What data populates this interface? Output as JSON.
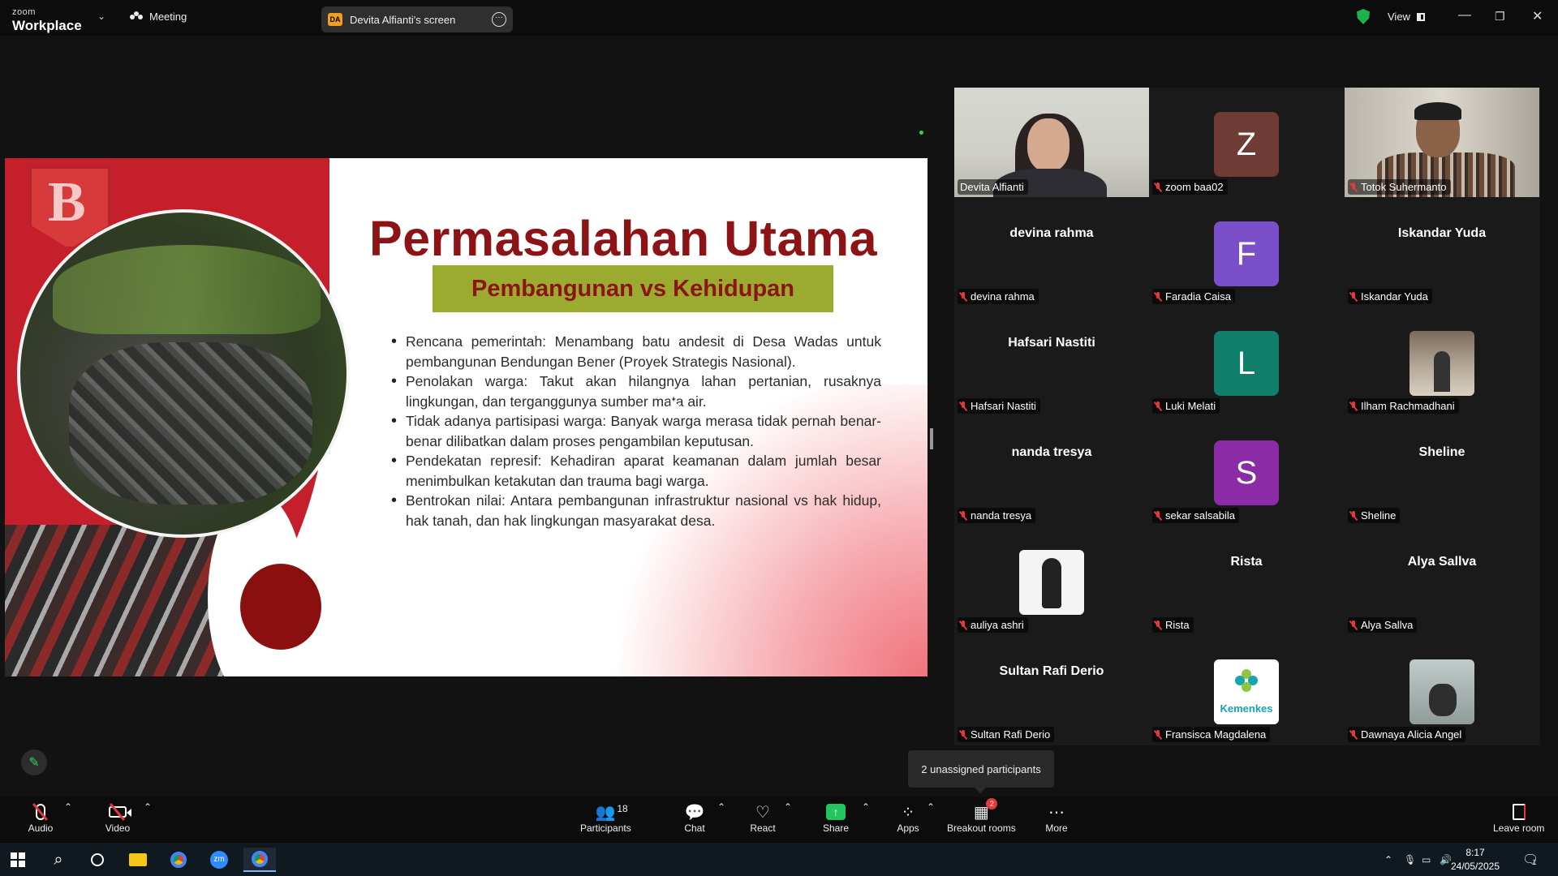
{
  "app": {
    "logo_top": "zoom",
    "logo_bottom": "Workplace",
    "meeting_label": "Meeting",
    "screen_share_pill": "Devita Alfianti's screen",
    "screen_share_initials": "DA",
    "view_label": "View"
  },
  "slide": {
    "title": "Permasalahan Utama",
    "subtitle": "Pembangunan vs Kehidupan",
    "logo_letter": "B",
    "bullets": [
      "Rencana pemerintah: Menambang batu andesit di Desa Wadas untuk pembangunan Bendungan Bener (Proyek Strategis Nasional).",
      "Penolakan warga: Takut akan hilangnya lahan pertanian, rusaknya lingkungan, dan terganggunya sumber mata air.",
      "Tidak adanya partisipasi warga: Banyak warga merasa tidak pernah benar-benar dilibatkan dalam proses pengambilan keputusan.",
      "Pendekatan represif: Kehadiran aparat keamanan dalam jumlah besar menimbulkan ketakutan dan trauma bagi warga.",
      "Bentrokan nilai: Antara pembangunan infrastruktur nasional vs hak hidup, hak tanah, dan hak lingkungan masyarakat desa."
    ]
  },
  "participants": [
    {
      "name": "Devita Alfianti",
      "type": "video-devita",
      "active": true,
      "muted": false
    },
    {
      "name": "zoom baa02",
      "type": "letter",
      "letter": "Z",
      "color": "#6e3b35",
      "muted": true
    },
    {
      "name": "Totok Suhermanto",
      "type": "video-totok",
      "muted": true
    },
    {
      "name": "devina rahma",
      "type": "name",
      "muted": true
    },
    {
      "name": "Faradia Caisa",
      "type": "letter",
      "letter": "F",
      "color": "#7b4fc9",
      "muted": true
    },
    {
      "name": "Iskandar Yuda",
      "type": "name",
      "muted": true
    },
    {
      "name": "Hafsari Nastiti",
      "type": "name",
      "muted": true
    },
    {
      "name": "Luki Melati",
      "type": "letter",
      "letter": "L",
      "color": "#0f7f6c",
      "muted": true
    },
    {
      "name": "Ilham Rachmadhani",
      "type": "pic-ilham",
      "muted": true
    },
    {
      "name": "nanda tresya",
      "type": "name",
      "muted": true
    },
    {
      "name": "sekar salsabila",
      "type": "letter",
      "letter": "S",
      "color": "#8b2ca6",
      "muted": true
    },
    {
      "name": "Sheline",
      "type": "name",
      "muted": true
    },
    {
      "name": "auliya ashri",
      "type": "pic-auliya",
      "muted": true
    },
    {
      "name": "Rista",
      "type": "name",
      "muted": true
    },
    {
      "name": "Alya Sallva",
      "type": "name",
      "muted": true
    },
    {
      "name": "Sultan Rafi Derio",
      "type": "name",
      "muted": true
    },
    {
      "name": "Fransisca Magdalena",
      "type": "pic-kemenkes",
      "logo_text": "Kemenkes",
      "muted": true
    },
    {
      "name": "Dawnaya Alicia Angel",
      "type": "pic-dawnaya",
      "muted": true
    }
  ],
  "unassigned_tooltip": "2 unassigned participants",
  "toolbar": {
    "audio": "Audio",
    "video": "Video",
    "participants": "Participants",
    "participants_count": "18",
    "chat": "Chat",
    "react": "React",
    "share": "Share",
    "apps": "Apps",
    "breakout": "Breakout rooms",
    "breakout_badge": "2",
    "more": "More",
    "leave": "Leave room"
  },
  "taskbar": {
    "time": "8:17",
    "date": "24/05/2025",
    "notification_count": "1"
  },
  "colors": {
    "accent_green": "#2fd65a",
    "muted_red": "#e5383b",
    "slide_title": "#8c1316",
    "slide_subtitle_bg": "#9aab2f"
  }
}
